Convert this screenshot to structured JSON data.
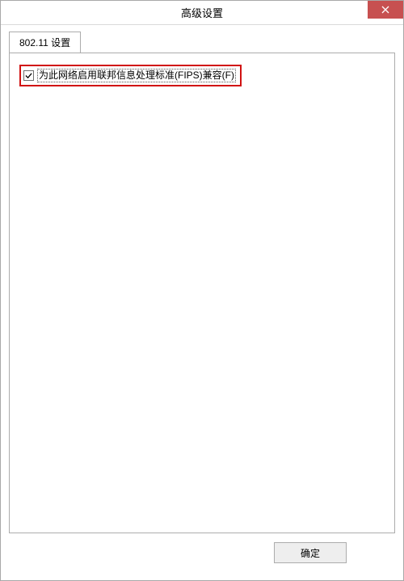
{
  "window": {
    "title": "高级设置"
  },
  "tab": {
    "label": "802.11 设置"
  },
  "option": {
    "fips_label": "为此网络启用联邦信息处理标准(FIPS)兼容(F)",
    "fips_checked": true
  },
  "buttons": {
    "ok": "确定"
  },
  "icons": {
    "close": "close-icon",
    "check": "check-icon"
  }
}
